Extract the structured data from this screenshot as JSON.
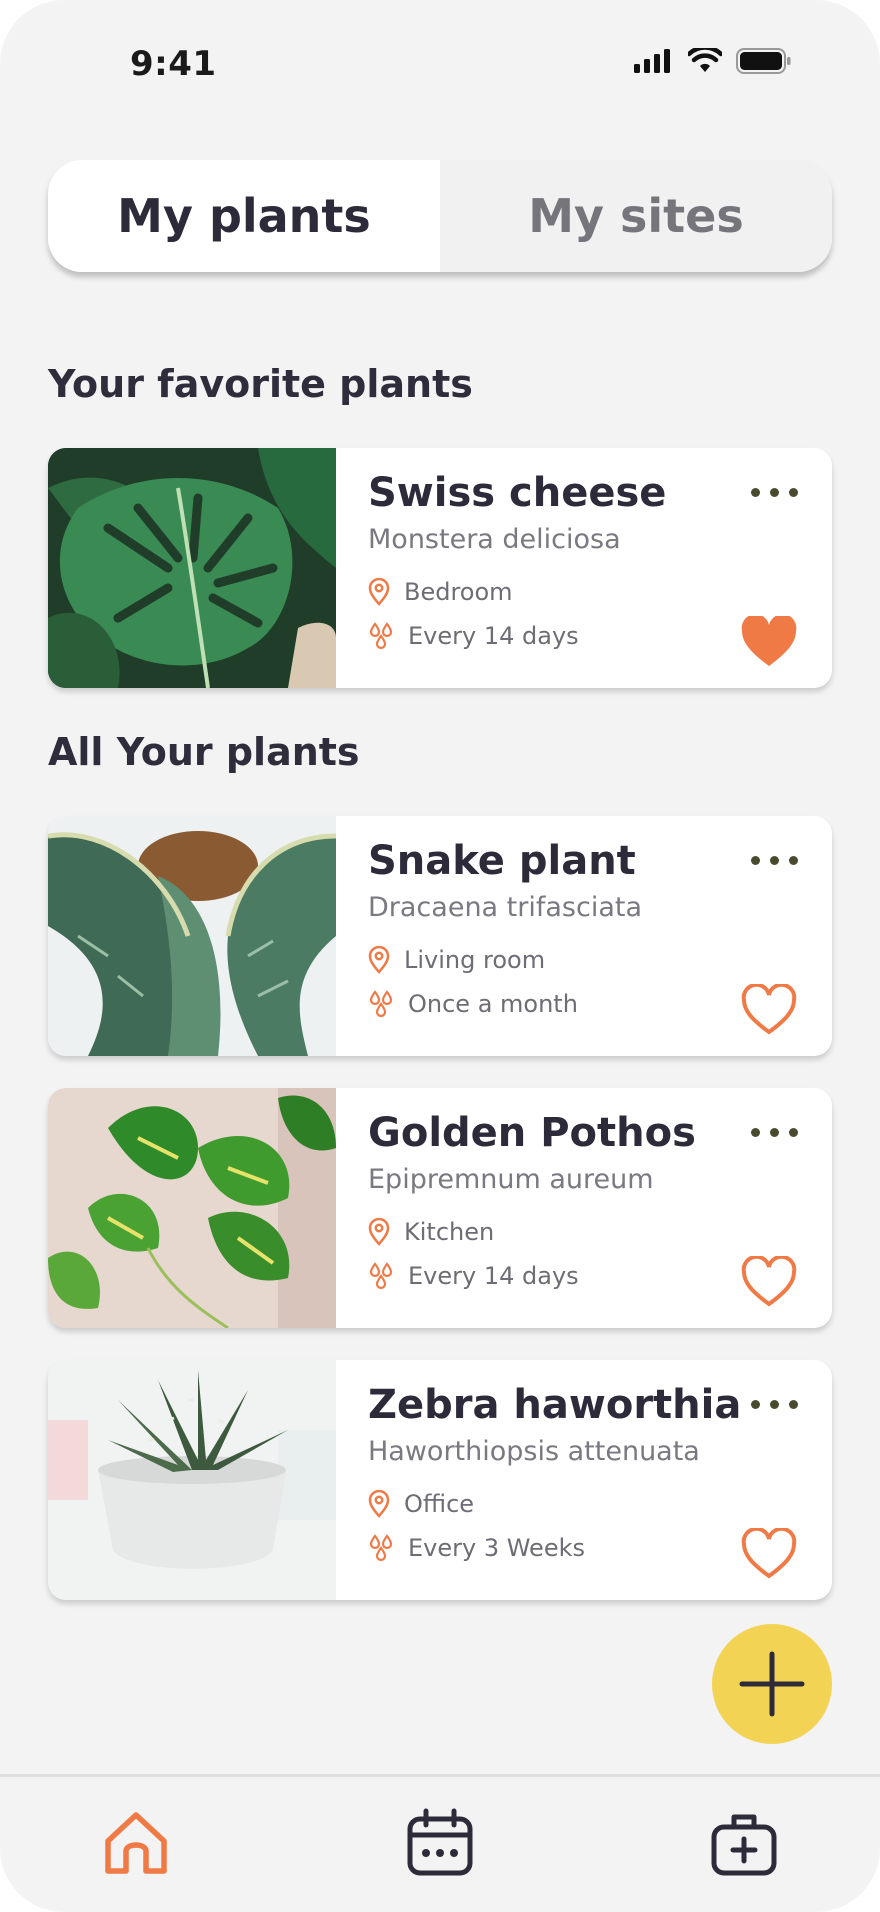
{
  "status_bar": {
    "time": "9:41"
  },
  "tabs": [
    {
      "label": "My plants",
      "active": true
    },
    {
      "label": "My sites",
      "active": false
    }
  ],
  "favorites": {
    "title": "Your favorite plants",
    "plants": [
      {
        "name": "Swiss cheese",
        "scientific": "Monstera deliciosa",
        "location": "Bedroom",
        "watering": "Every 14 days",
        "favorite": true
      }
    ]
  },
  "all_plants": {
    "title": "All Your plants",
    "plants": [
      {
        "name": "Snake plant",
        "scientific": "Dracaena trifasciata",
        "location": "Living room",
        "watering": "Once a month",
        "favorite": false
      },
      {
        "name": "Golden Pothos",
        "scientific": "Epipremnum aureum",
        "location": "Kitchen",
        "watering": "Every 14 days",
        "favorite": false
      },
      {
        "name": "Zebra haworthia",
        "scientific": "Haworthiopsis attenuata",
        "location": "Office",
        "watering": "Every 3 Weeks",
        "favorite": false
      }
    ]
  },
  "fab": {
    "icon": "plus-icon"
  },
  "bottom_nav": [
    {
      "icon": "home-icon",
      "active": true
    },
    {
      "icon": "calendar-icon",
      "active": false
    },
    {
      "icon": "first-aid-kit-icon",
      "active": false
    }
  ],
  "colors": {
    "accent": "#f07a45",
    "fab": "#f2d353",
    "text": "#2d2a3a",
    "background": "#f3f3f3"
  }
}
